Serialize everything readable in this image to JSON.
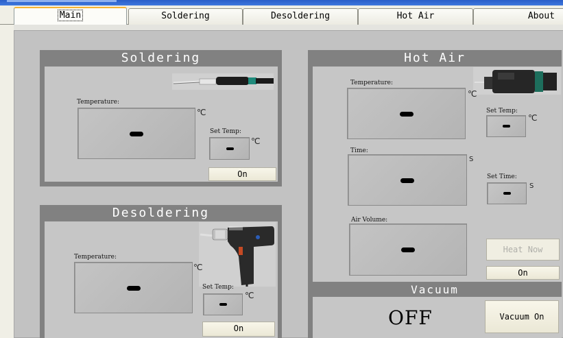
{
  "tabs": [
    "Main",
    "Soldering",
    "Desoldering",
    "Hot Air",
    "About"
  ],
  "soldering": {
    "title": "Soldering",
    "temperature_label": "Temperature:",
    "temperature_unit": "℃",
    "set_temp_label": "Set Temp:",
    "set_temp_unit": "℃",
    "on_button": "On"
  },
  "desoldering": {
    "title": "Desoldering",
    "temperature_label": "Temperature:",
    "temperature_unit": "℃",
    "set_temp_label": "Set Temp:",
    "set_temp_unit": "℃",
    "on_button": "On"
  },
  "hot_air": {
    "title": "Hot Air",
    "temperature_label": "Temperature:",
    "temperature_unit": "℃",
    "set_temp_label": "Set Temp:",
    "set_temp_unit": "℃",
    "time_label": "Time:",
    "time_unit": "S",
    "set_time_label": "Set Time:",
    "set_time_unit": "S",
    "air_volume_label": "Air Volume:",
    "heat_now_button": "Heat Now",
    "on_button": "On"
  },
  "vacuum": {
    "title": "Vacuum",
    "status": "OFF",
    "button": "Vacuum On"
  },
  "colors": {
    "panel_header": "#818181",
    "panel_body": "#c6c6c6",
    "tab_accent": "#f5b335"
  }
}
